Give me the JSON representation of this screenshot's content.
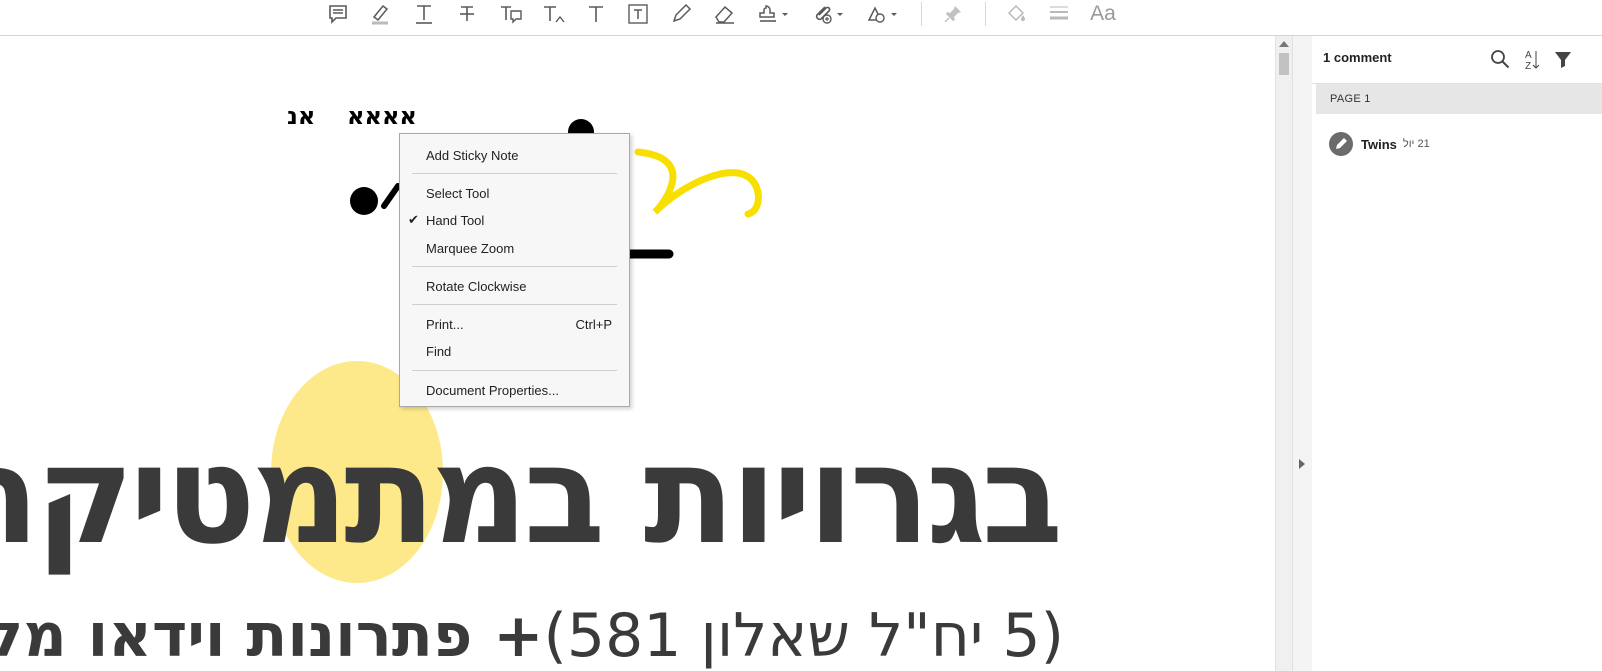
{
  "toolbar": {
    "tools": [
      {
        "name": "add-comment",
        "icon": "speech-bubble-icon"
      },
      {
        "name": "highlight",
        "icon": "highlighter-icon"
      },
      {
        "name": "underline-text",
        "icon": "underline-text-icon"
      },
      {
        "name": "strikethrough-text",
        "icon": "strikethrough-icon"
      },
      {
        "name": "replace-text",
        "icon": "replace-text-icon"
      },
      {
        "name": "insert-text",
        "icon": "insert-text-icon"
      },
      {
        "name": "add-text-comment",
        "icon": "text-icon"
      },
      {
        "name": "text-box",
        "icon": "text-box-icon"
      },
      {
        "name": "draw-free-form",
        "icon": "pencil-icon"
      },
      {
        "name": "erase",
        "icon": "eraser-icon"
      },
      {
        "name": "stamp",
        "icon": "stamp-icon"
      },
      {
        "name": "attach-file",
        "icon": "paperclip-icon"
      },
      {
        "name": "drawing-tools",
        "icon": "shapes-icon"
      },
      {
        "name": "pin",
        "icon": "pushpin-icon"
      },
      {
        "name": "fill-color",
        "icon": "paint-bucket-icon"
      },
      {
        "name": "line-weight",
        "icon": "line-weight-icon"
      }
    ],
    "font_label": "Aa"
  },
  "document": {
    "small_text_left": "אנ",
    "small_text_right": "אאאא",
    "big_title": "בגרויות במתמטיקה",
    "subtitle_bold": "+ פתרונות וידאו מלאים",
    "subtitle_light": "(5 יח\"ל שאלון 581)"
  },
  "context_menu": {
    "items": [
      {
        "label": "Add Sticky Note",
        "shortcut": "",
        "checked": false
      },
      {
        "label": "Select Tool",
        "shortcut": "",
        "checked": false
      },
      {
        "label": "Hand Tool",
        "shortcut": "",
        "checked": true
      },
      {
        "label": "Marquee Zoom",
        "shortcut": "",
        "checked": false
      },
      {
        "label": "Rotate Clockwise",
        "shortcut": "",
        "checked": false
      },
      {
        "label": "Print...",
        "shortcut": "Ctrl+P",
        "checked": false
      },
      {
        "label": "Find",
        "shortcut": "",
        "checked": false
      },
      {
        "label": "Document Properties...",
        "shortcut": "",
        "checked": false
      }
    ],
    "check_glyph": "✔"
  },
  "comments_panel": {
    "count_label": "1 comment",
    "page_header": "PAGE 1",
    "comments": [
      {
        "author": "Twins",
        "date": "21 יול"
      }
    ]
  },
  "colors": {
    "annotation_yellow": "#f7e000",
    "highlight_yellow": "#fde98a",
    "title_gray": "#3a3a3a",
    "toolbar_icon": "#5a5a5a"
  }
}
